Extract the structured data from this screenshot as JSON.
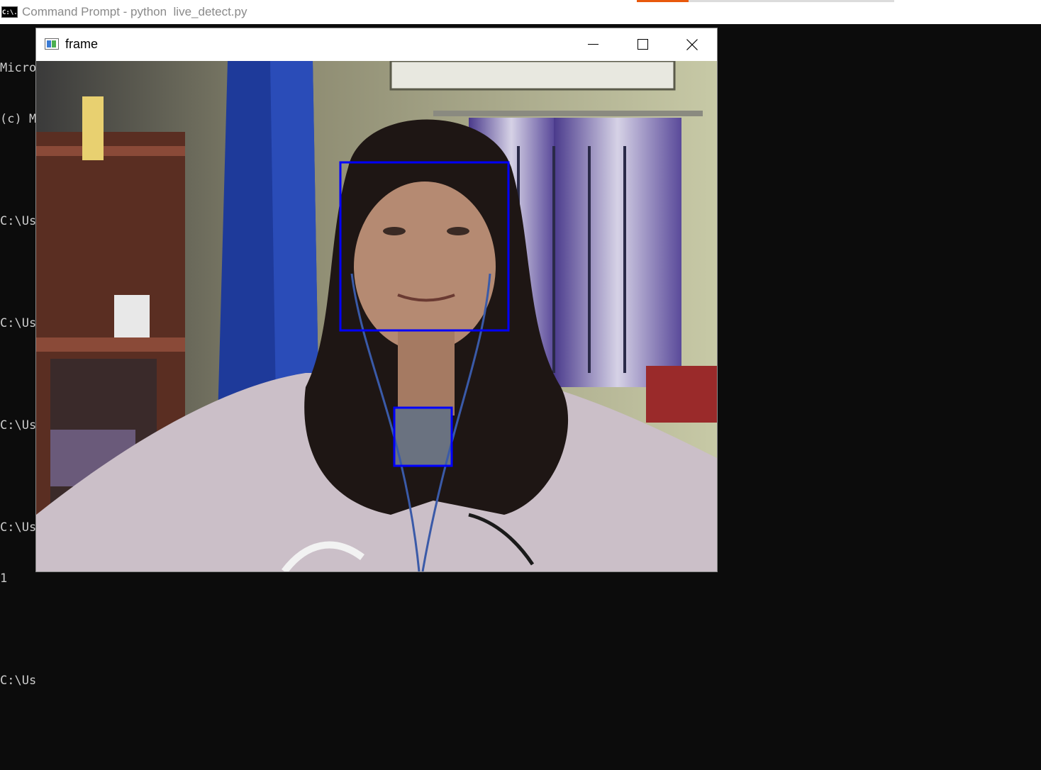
{
  "cmd": {
    "title": "Command Prompt - python  live_detect.py",
    "icon_text": "C:\\.",
    "lines": [
      "Micro",
      "(c) M",
      "",
      "C:\\Us",
      "",
      "C:\\Us",
      "",
      "C:\\Us",
      "",
      "C:\\Us",
      "1",
      "",
      "C:\\Us"
    ]
  },
  "frame_window": {
    "title": "frame",
    "minimize": "minimize",
    "maximize": "maximize",
    "close": "close"
  },
  "detections": {
    "box_color": "#0000ff"
  },
  "colors": {
    "console_bg": "#0c0c0c",
    "console_text": "#cccccc",
    "accent_tab": "#e8590c"
  }
}
